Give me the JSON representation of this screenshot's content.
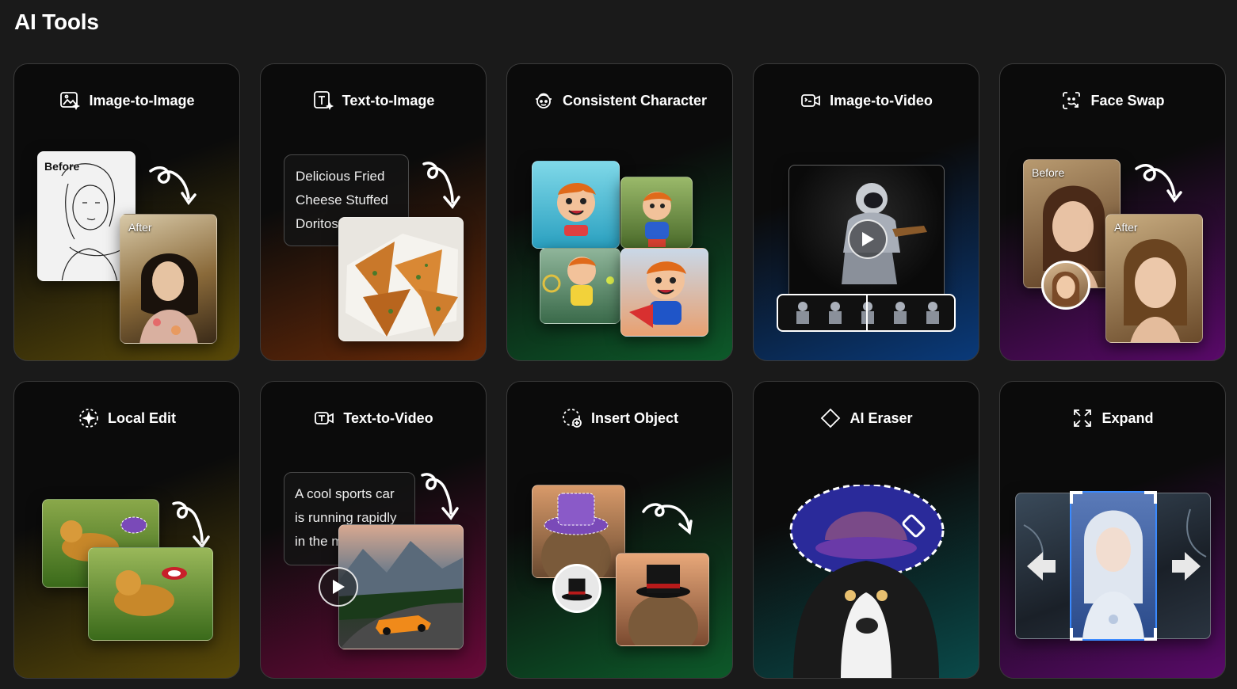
{
  "page": {
    "title": "AI Tools"
  },
  "cards": [
    {
      "title": "Image-to-Image",
      "before": "Before",
      "after": "After"
    },
    {
      "title": "Text-to-Image",
      "prompt": "Delicious Fried Cheese Stuffed Doritos"
    },
    {
      "title": "Consistent Character"
    },
    {
      "title": "Image-to-Video"
    },
    {
      "title": "Face Swap",
      "before": "Before",
      "after": "After"
    },
    {
      "title": "Local Edit"
    },
    {
      "title": "Text-to-Video",
      "prompt": "A cool sports car is running rapidly in the mountains"
    },
    {
      "title": "Insert Object"
    },
    {
      "title": "AI Eraser"
    },
    {
      "title": "Expand"
    }
  ],
  "colors": {
    "bg": "#1a1a1a",
    "image_to_image": "#5a4a08",
    "text_to_image": "#6a2a08",
    "consistent_character": "#0d5a2a",
    "image_to_video": "#0a3a7a",
    "face_swap": "#5a0a6a",
    "local_edit": "#5a4a08",
    "text_to_video": "#6a0a3a",
    "insert_object": "#0d5a2a",
    "ai_eraser": "#0a4a4a",
    "expand": "#5a0a6a"
  },
  "icons": [
    "image-sparkle-icon",
    "text-sparkle-icon",
    "character-icon",
    "video-camera-icon",
    "face-swap-icon",
    "dashed-sparkle-icon",
    "text-video-icon",
    "dashed-plus-icon",
    "eraser-icon",
    "expand-icon",
    "curly-arrow-icon",
    "play-icon"
  ]
}
